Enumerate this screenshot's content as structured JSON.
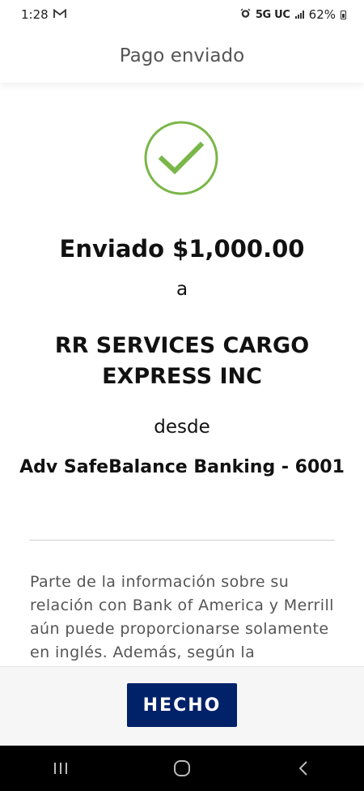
{
  "status_bar": {
    "time": "1:28",
    "notification_icon": "gmail-icon",
    "alarm_icon": "alarm-icon",
    "network": "5G UC",
    "battery": "62%"
  },
  "header": {
    "title": "Pago enviado"
  },
  "confirmation": {
    "icon": "checkmark-circle-icon",
    "sent_line": "Enviado $1,000.00",
    "to_word": "a",
    "payee": "RR SERVICES CARGO EXPRESS INC",
    "from_word": "desde",
    "account": "Adv SafeBalance Banking - 6001"
  },
  "disclaimer": "Parte de la información sobre su relación con Bank of America y Merrill aún puede proporcionarse solamente en inglés. Además, según la",
  "actions": {
    "done_label": "HECHO"
  },
  "nav": {
    "recents_icon": "recents-icon",
    "home_icon": "home-icon",
    "back_icon": "back-icon"
  },
  "colors": {
    "accent": "#012169",
    "success": "#7ab648"
  }
}
